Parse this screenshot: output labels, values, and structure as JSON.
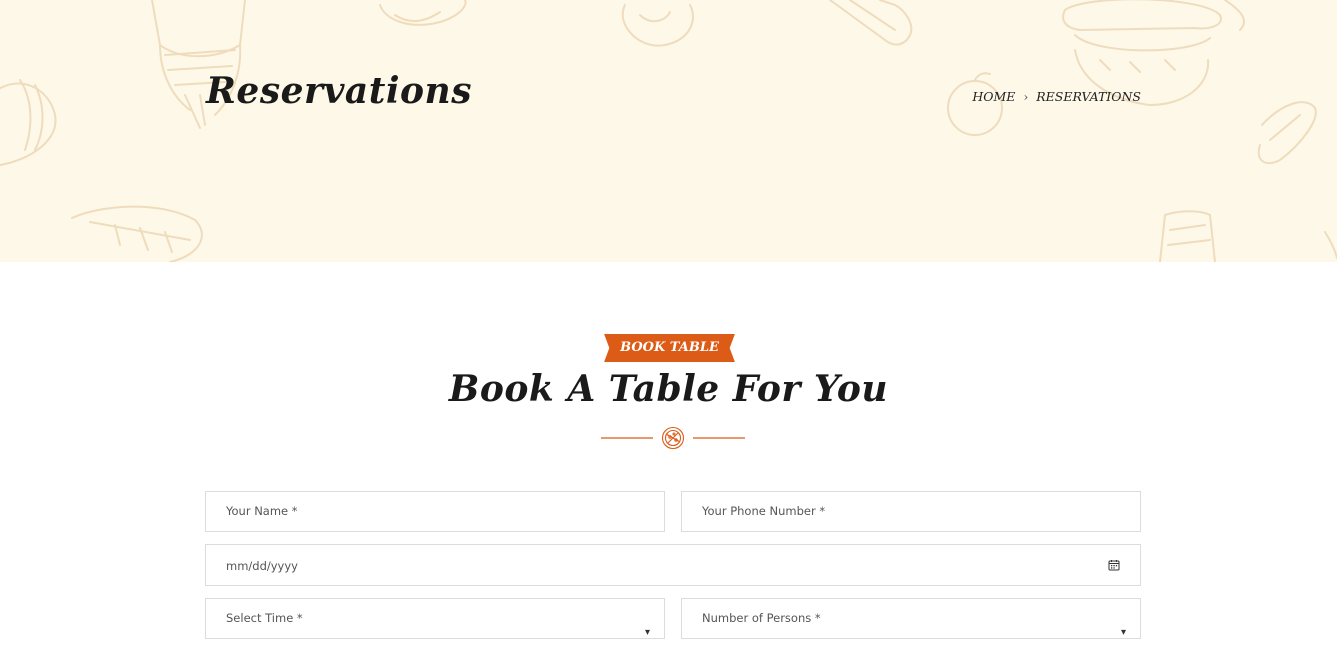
{
  "hero": {
    "title": "Reservations",
    "breadcrumb": {
      "home": "HOME",
      "separator": "›",
      "current": "RESERVATIONS"
    }
  },
  "section": {
    "tag": "BOOK TABLE",
    "title": "Book A Table For You"
  },
  "form": {
    "name_placeholder": "Your Name *",
    "phone_placeholder": "Your Phone Number *",
    "date_placeholder": "mm/dd/yyyy",
    "time_placeholder": "Select Time *",
    "persons_placeholder": "Number of Persons *"
  },
  "colors": {
    "hero_bg": "#fef8e8",
    "accent": "#dc5b17",
    "doodle": "#efdcbd"
  },
  "icons": {
    "calendar": "calendar-icon",
    "dropdown": "chevron-down-icon",
    "divider_emblem": "pizza-icon"
  }
}
